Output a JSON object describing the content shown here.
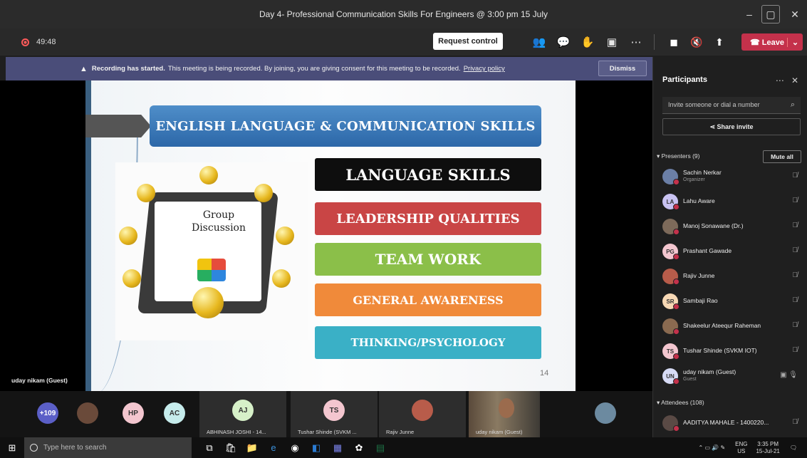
{
  "window": {
    "title": "Day 4- Professional Communication Skills For Engineers @ 3:00 pm 15 July"
  },
  "toolbar": {
    "timer": "49:48",
    "request_control": "Request control",
    "leave": "Leave"
  },
  "banner": {
    "bold": "Recording has started.",
    "text": "This meeting is being recorded. By joining, you are giving consent for this meeting to be recorded.",
    "link": "Privacy policy",
    "dismiss": "Dismiss"
  },
  "slide": {
    "headline": "ENGLISH LANGUAGE & COMMUNICATION SKILLS",
    "image_label": "Group Discussion",
    "skills": [
      "LANGUAGE SKILLS",
      "LEADERSHIP QUALITIES",
      "TEAM WORK",
      "GENERAL AWARENESS",
      "THINKING/PSYCHOLOGY"
    ],
    "page": "14"
  },
  "stage_presenter": "uday nikam (Guest)",
  "panel": {
    "title": "Participants",
    "invite_placeholder": "Invite someone or dial a number",
    "share_invite": "Share invite",
    "presenters_label": "Presenters (9)",
    "mute_all": "Mute all",
    "attendees_label": "Attendees (108)",
    "presenters": [
      {
        "initials": "",
        "name": "Sachin Nerkar",
        "role": "Organizer",
        "color": "#6b7fa6"
      },
      {
        "initials": "LA",
        "name": "Lahu Aware",
        "role": "",
        "color": "#c9c3f2"
      },
      {
        "initials": "",
        "name": "Manoj Sonawane (Dr.)",
        "role": "",
        "color": "#7d6a5a"
      },
      {
        "initials": "PG",
        "name": "Prashant Gawade",
        "role": "",
        "color": "#f3c6cf"
      },
      {
        "initials": "",
        "name": "Rajiv Junne",
        "role": "",
        "color": "#b85c4a"
      },
      {
        "initials": "SR",
        "name": "Sambaji Rao",
        "role": "",
        "color": "#f7d8b5"
      },
      {
        "initials": "",
        "name": "Shakeelur Ateequr Raheman",
        "role": "",
        "color": "#8a6a50"
      },
      {
        "initials": "TS",
        "name": "Tushar Shinde (SVKM IOT)",
        "role": "",
        "color": "#f3c6cf"
      },
      {
        "initials": "UN",
        "name": "uday nikam (Guest)",
        "role": "Guest",
        "color": "#d7dbf5"
      }
    ],
    "attendee": {
      "name": "AADITYA MAHALE - 1400220...",
      "color": "#5a4a45"
    }
  },
  "strip": {
    "bubbles": [
      {
        "label": "+109",
        "color": "#5b5fc7"
      },
      {
        "label": "",
        "color": "#6a4a3a"
      },
      {
        "label": "HP",
        "color": "#f3c6cf"
      },
      {
        "label": "AC",
        "color": "#c6ecec"
      }
    ],
    "tiles": [
      {
        "initials": "AJ",
        "caption": "ABHINASH JOSHI - 14...",
        "color": "#d6f0c8"
      },
      {
        "initials": "TS",
        "caption": "Tushar Shinde (SVKM ...",
        "color": "#f3c6cf"
      },
      {
        "initials": "",
        "caption": "Rajiv Junne",
        "color": "#b85c4a"
      }
    ],
    "video_caption": "uday nikam (Guest)"
  },
  "taskbar": {
    "search_placeholder": "Type here to search",
    "lang": "ENG",
    "region": "US",
    "time": "3:35 PM",
    "date": "15-Jul-21"
  }
}
